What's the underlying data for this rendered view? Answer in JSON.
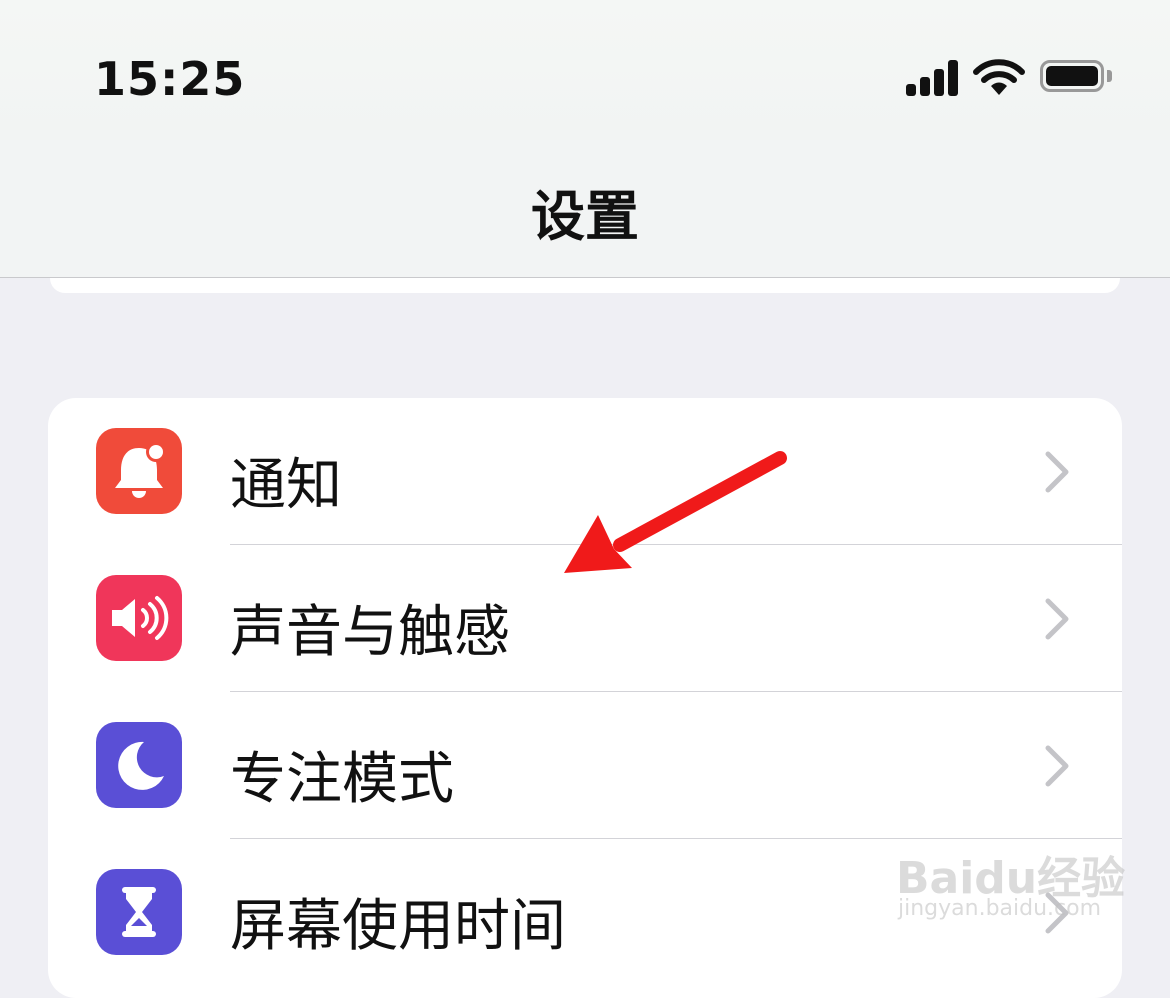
{
  "status_bar": {
    "time": "15:25",
    "signal_icon": "cellular-signal-icon",
    "wifi_icon": "wifi-icon",
    "battery_icon": "battery-icon"
  },
  "nav": {
    "title": "设置"
  },
  "settings": [
    {
      "label": "通知",
      "icon": "notification-bell-icon",
      "color": "#f04b3a"
    },
    {
      "label": "声音与触感",
      "icon": "speaker-icon",
      "color": "#f0365a"
    },
    {
      "label": "专注模式",
      "icon": "moon-icon",
      "color": "#5a4fd6"
    },
    {
      "label": "屏幕使用时间",
      "icon": "hourglass-icon",
      "color": "#5a4fd6"
    }
  ],
  "annotation": {
    "arrow_color": "#f01a1a"
  },
  "watermark": {
    "brand": "Baidu经验",
    "url": "jingyan.baidu.com"
  }
}
